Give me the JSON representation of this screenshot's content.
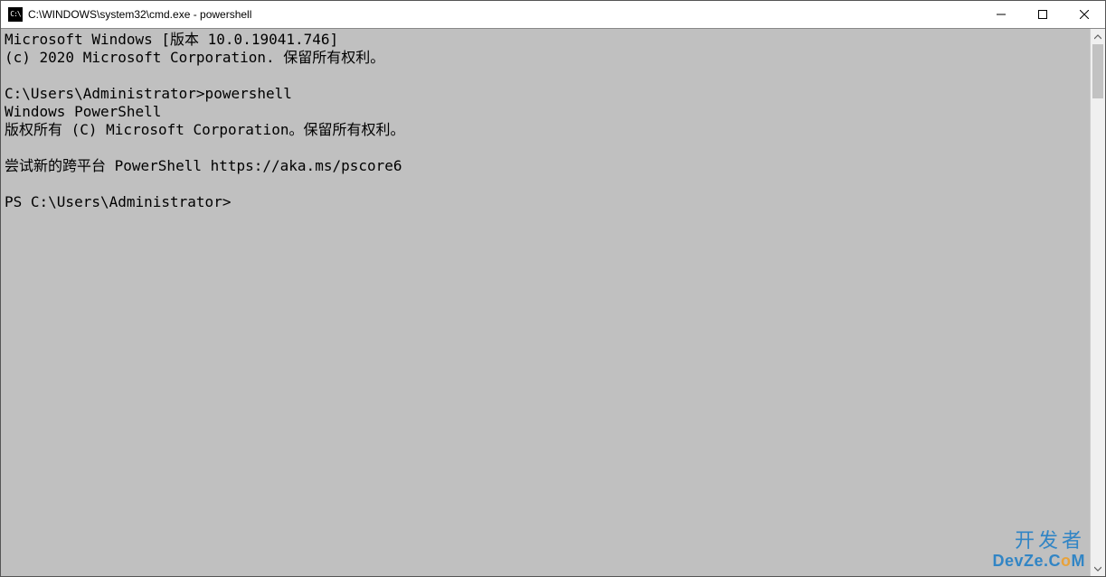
{
  "titlebar": {
    "title": "C:\\WINDOWS\\system32\\cmd.exe - powershell"
  },
  "terminal": {
    "lines": [
      "Microsoft Windows [版本 10.0.19041.746]",
      "(c) 2020 Microsoft Corporation. 保留所有权利。",
      "",
      "C:\\Users\\Administrator>powershell",
      "Windows PowerShell",
      "版权所有 (C) Microsoft Corporation。保留所有权利。",
      "",
      "尝试新的跨平台 PowerShell https://aka.ms/pscore6",
      "",
      "PS C:\\Users\\Administrator>"
    ]
  },
  "watermark": {
    "cn": "开发者",
    "en_prefix": "DevZe.C",
    "en_o": "o",
    "en_suffix": "M"
  }
}
